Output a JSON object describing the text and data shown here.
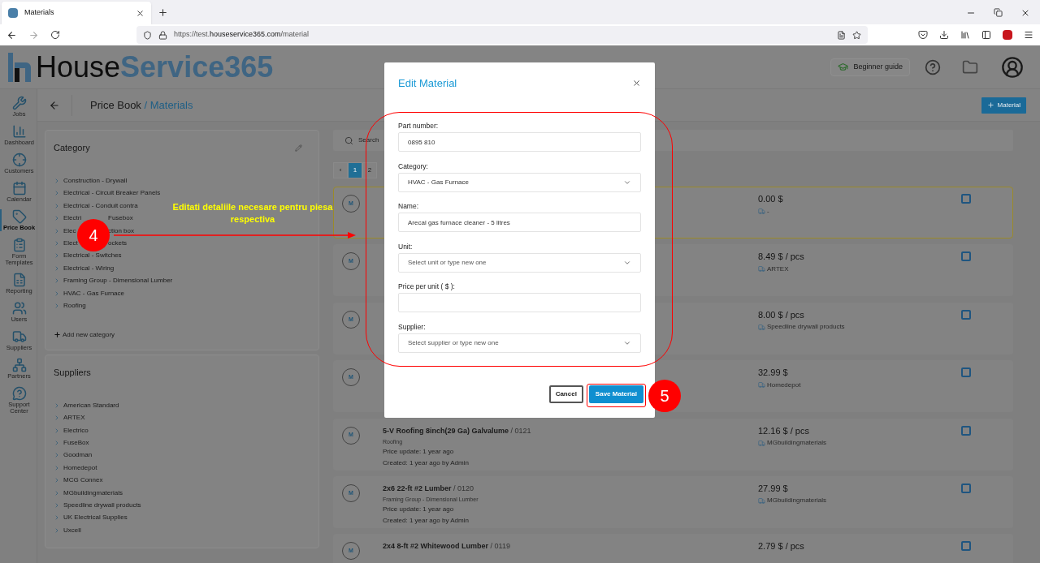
{
  "browser": {
    "tab_title": "Materials",
    "url_prefix": "https://test.",
    "url_domain": "houseservice365.com",
    "url_path": "/material"
  },
  "header": {
    "logo_first": "House",
    "logo_second": "Service365",
    "beginner_guide": "Beginner guide"
  },
  "nav": [
    {
      "label": "Jobs",
      "selected": false
    },
    {
      "label": "Dashboard",
      "selected": false
    },
    {
      "label": "Customers",
      "selected": false
    },
    {
      "label": "Calendar",
      "selected": false
    },
    {
      "label": "Price Book",
      "selected": true
    },
    {
      "label": "Form Templates",
      "selected": false
    },
    {
      "label": "Reporting",
      "selected": false
    },
    {
      "label": "Users",
      "selected": false
    },
    {
      "label": "Suppliers",
      "selected": false
    },
    {
      "label": "Partners",
      "selected": false
    },
    {
      "label": "Support Center",
      "selected": false
    }
  ],
  "page_title": {
    "section": "Price Book",
    "current": "/ Materials",
    "add_button": "Material"
  },
  "category": {
    "title": "Category",
    "items": [
      {
        "label": "Construction - Drywall"
      },
      {
        "label": "Electrical - Circuit Breaker Panels"
      },
      {
        "label": "Electrical - Conduit contra"
      },
      {
        "label": "Electri",
        "label_after": "Fusebox"
      },
      {
        "label": "Elec",
        "label_after": "ction box"
      },
      {
        "label": "Elect",
        "label_after": "ockets"
      },
      {
        "label": "Electrical - Switches"
      },
      {
        "label": "Electrical - Wiring"
      },
      {
        "label": "Framing Group - Dimensional Lumber"
      },
      {
        "label": "HVAC - Gas Furnace"
      },
      {
        "label": "Roofing"
      }
    ],
    "add_label": "Add new category"
  },
  "suppliers": {
    "title": "Suppliers",
    "items": [
      {
        "label": "American Standard"
      },
      {
        "label": "ARTEX"
      },
      {
        "label": "Electrico"
      },
      {
        "label": "FuseBox"
      },
      {
        "label": "Goodman"
      },
      {
        "label": "Homedepot"
      },
      {
        "label": "MCG Connex"
      },
      {
        "label": "MGbuildingmaterials"
      },
      {
        "label": "Speedline drywall products"
      },
      {
        "label": "UK Electrical Supplies"
      },
      {
        "label": "Uxcell"
      }
    ]
  },
  "search": {
    "placeholder": "Search"
  },
  "pagination": [
    {
      "label": "‹",
      "selected": false
    },
    {
      "label": "1",
      "selected": true
    },
    {
      "label": "2",
      "selected": false
    }
  ],
  "materials": [
    {
      "avatar": "M",
      "price": "0.00 $",
      "supplier": "-",
      "checked": false,
      "selected": true
    },
    {
      "avatar": "M",
      "price": "8.49 $ / pcs",
      "supplier": "ARTEX",
      "checked": false,
      "selected": false
    },
    {
      "avatar": "M",
      "price": "8.00 $ / pcs",
      "supplier": "Speedline drywall products",
      "checked": false,
      "selected": false
    },
    {
      "avatar": "M",
      "price": "32.99 $",
      "supplier": "Homedepot",
      "checked": false,
      "selected": false
    },
    {
      "avatar": "M",
      "title": "5-V Roofing 8inch(29 Ga) Galvalume",
      "code": "/ 0121",
      "category": "Roofing",
      "price_update": "Price update: 1 year ago",
      "created": "Created: 1 year ago by Admin",
      "price": "12.16 $ / pcs",
      "supplier": "MGbuildingmaterials",
      "checked": false,
      "selected": false
    },
    {
      "avatar": "M",
      "title": "2x6 22-ft #2 Lumber",
      "code": "/ 0120",
      "category": "Framing Group - Dimensional Lumber",
      "price_update": "Price update: 1 year ago",
      "created": "Created: 1 year ago by Admin",
      "price": "27.99 $",
      "supplier": "MGbuildingmaterials",
      "checked": false,
      "selected": false
    },
    {
      "avatar": "M",
      "title": "2x4 8-ft #2 Whitewood Lumber",
      "code": "/ 0119",
      "price": "2.79 $ / pcs",
      "checked": false,
      "selected": false
    }
  ],
  "modal": {
    "title": "Edit Material",
    "fields": [
      {
        "kind": "text",
        "label": "Part number:",
        "value": "0895 810"
      },
      {
        "kind": "select",
        "label": "Category:",
        "value": "HVAC - Gas Furnace"
      },
      {
        "kind": "text",
        "label": "Name:",
        "value": "Arecal gas furnace cleaner - 5 litres"
      },
      {
        "kind": "select",
        "label": "Unit:",
        "placeholder": "Select unit or type new one"
      },
      {
        "kind": "text",
        "label": "Price per unit ( $ ):"
      },
      {
        "kind": "select",
        "label": "Supplier:",
        "placeholder": "Select supplier or type new one"
      }
    ],
    "cancel": "Cancel",
    "save": "Save Material"
  },
  "annotations": {
    "callout": "Editati detaliile necesare pentru piesa respectiva",
    "steps": [
      "4",
      "5"
    ]
  }
}
